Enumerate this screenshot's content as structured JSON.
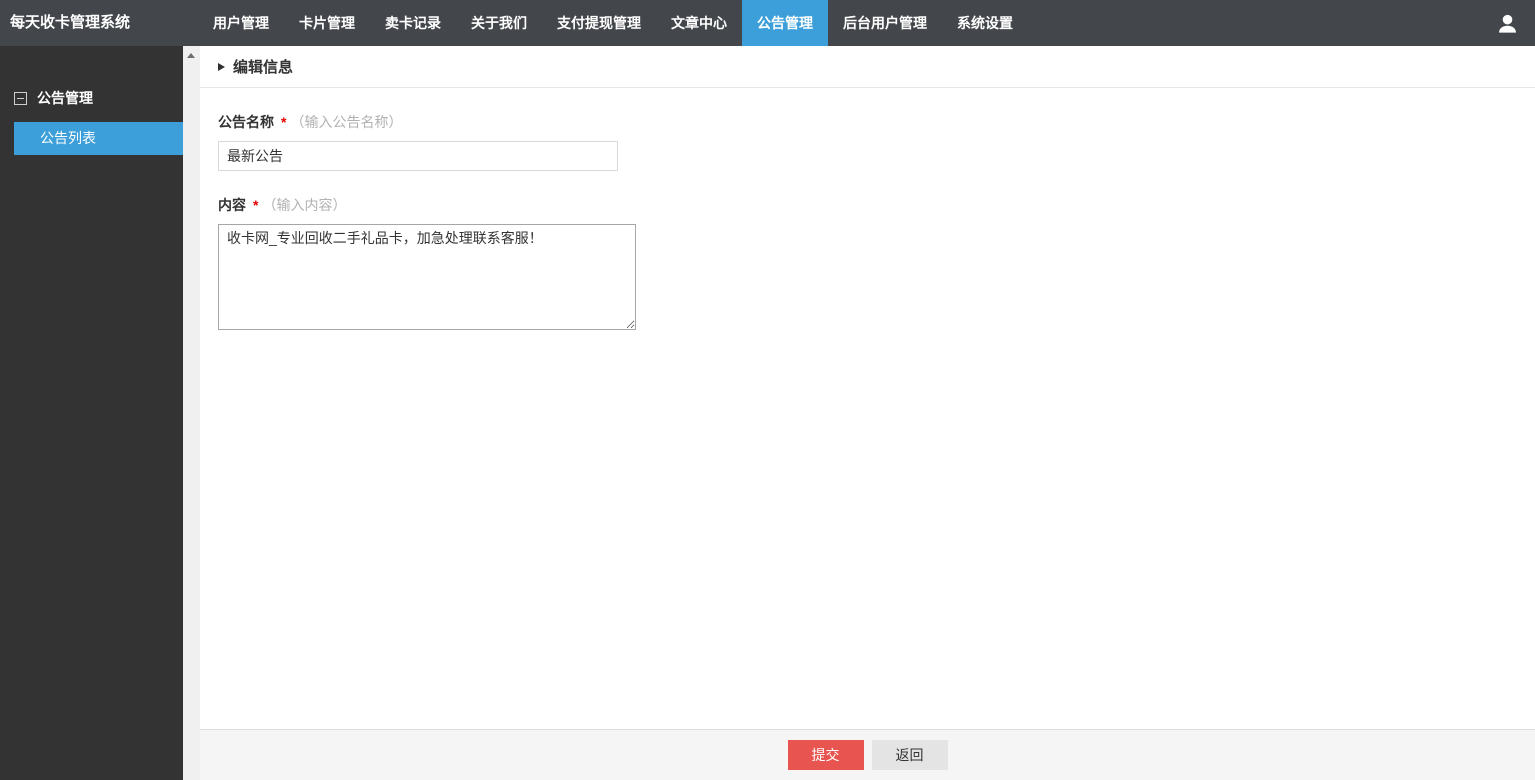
{
  "topbar": {
    "brand": "每天收卡管理系统",
    "nav": [
      {
        "label": "用户管理",
        "active": false
      },
      {
        "label": "卡片管理",
        "active": false
      },
      {
        "label": "卖卡记录",
        "active": false
      },
      {
        "label": "关于我们",
        "active": false
      },
      {
        "label": "支付提现管理",
        "active": false
      },
      {
        "label": "文章中心",
        "active": false
      },
      {
        "label": "公告管理",
        "active": true
      },
      {
        "label": "后台用户管理",
        "active": false
      },
      {
        "label": "系统设置",
        "active": false
      }
    ]
  },
  "sidebar": {
    "group_label": "公告管理",
    "items": [
      {
        "label": "公告列表",
        "active": true
      }
    ]
  },
  "main": {
    "section_title": "编辑信息",
    "form": {
      "name": {
        "label": "公告名称",
        "required_mark": "*",
        "hint": "（输入公告名称）",
        "value": "最新公告"
      },
      "content": {
        "label": "内容",
        "required_mark": "*",
        "hint": "（输入内容）",
        "value": "收卡网_专业回收二手礼品卡，加急处理联系客服！"
      }
    },
    "footer": {
      "submit_label": "提交",
      "back_label": "返回"
    }
  },
  "icons": {
    "user": "person-icon",
    "sidebar_collapse": "minus-square-icon",
    "section_marker": "caret-right-icon",
    "scrollbar_up": "triangle-up-icon"
  },
  "colors": {
    "topbar_bg": "#43474c",
    "sidebar_bg": "#333333",
    "accent_blue": "#3c9fd9",
    "submit_red": "#e8544f",
    "required_red": "#e60000",
    "footer_bg": "#f5f5f5"
  }
}
